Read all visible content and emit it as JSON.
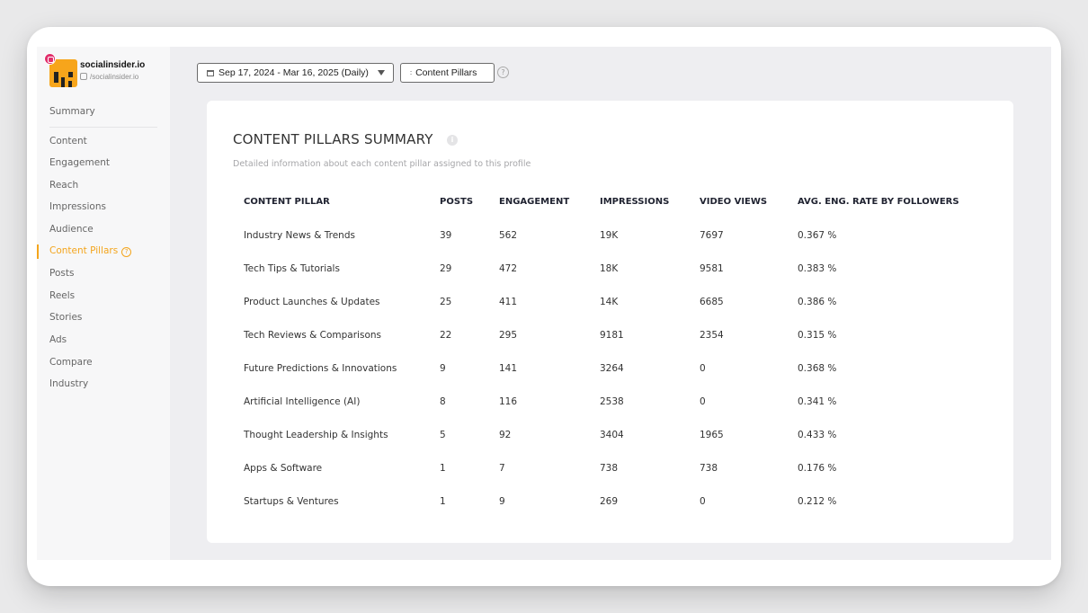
{
  "profile": {
    "name": "socialinsider.io",
    "handle": "/socialinsider.io"
  },
  "sidebar": {
    "items": [
      {
        "label": "Summary"
      },
      {
        "label": "Content"
      },
      {
        "label": "Engagement"
      },
      {
        "label": "Reach"
      },
      {
        "label": "Impressions"
      },
      {
        "label": "Audience"
      },
      {
        "label": "Content Pillars",
        "active": true
      },
      {
        "label": "Posts"
      },
      {
        "label": "Reels"
      },
      {
        "label": "Stories"
      },
      {
        "label": "Ads"
      },
      {
        "label": "Compare"
      },
      {
        "label": "Industry"
      }
    ]
  },
  "toolbar": {
    "date_range": "Sep 17, 2024 - Mar 16, 2025 (Daily)",
    "pillars_button": "Content Pillars",
    "help": "?"
  },
  "summary": {
    "title": "CONTENT PILLARS SUMMARY",
    "info": "i",
    "subtitle": "Detailed information about each content pillar assigned to this profile",
    "columns": [
      "CONTENT PILLAR",
      "POSTS",
      "ENGAGEMENT",
      "IMPRESSIONS",
      "VIDEO VIEWS",
      "AVG. ENG. RATE BY FOLLOWERS"
    ],
    "rows": [
      [
        "Industry News & Trends",
        "39",
        "562",
        "19K",
        "7697",
        "0.367 %"
      ],
      [
        "Tech Tips & Tutorials",
        "29",
        "472",
        "18K",
        "9581",
        "0.383 %"
      ],
      [
        "Product Launches & Updates",
        "25",
        "411",
        "14K",
        "6685",
        "0.386 %"
      ],
      [
        "Tech Reviews & Comparisons",
        "22",
        "295",
        "9181",
        "2354",
        "0.315 %"
      ],
      [
        "Future Predictions & Innovations",
        "9",
        "141",
        "3264",
        "0",
        "0.368 %"
      ],
      [
        "Artificial Intelligence (AI)",
        "8",
        "116",
        "2538",
        "0",
        "0.341 %"
      ],
      [
        "Thought Leadership & Insights",
        "5",
        "92",
        "3404",
        "1965",
        "0.433 %"
      ],
      [
        "Apps & Software",
        "1",
        "7",
        "738",
        "738",
        "0.176 %"
      ],
      [
        "Startups & Ventures",
        "1",
        "9",
        "269",
        "0",
        "0.212 %"
      ]
    ]
  },
  "colors": {
    "accent": "#f4a51c",
    "instagram": "#e1306c",
    "background": "#eeeef1"
  }
}
